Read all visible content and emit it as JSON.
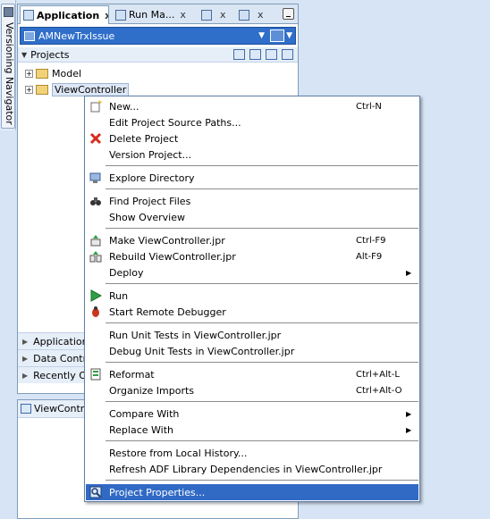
{
  "versioning_navigator": {
    "label": "Versioning Navigator"
  },
  "tabs": [
    {
      "label": "Application",
      "close": "x"
    },
    {
      "label": "Run Ma...",
      "close": "x"
    },
    {
      "label": "",
      "close": "x"
    },
    {
      "label": "",
      "close": "x"
    }
  ],
  "app_selector": {
    "label": "AMNewTrxIssue",
    "dropdown": "▼"
  },
  "projects_header": {
    "title": "Projects"
  },
  "tree": [
    {
      "label": "Model",
      "expander": "+"
    },
    {
      "label": "ViewController",
      "expander": "+"
    }
  ],
  "accordions": [
    {
      "label": "Application R"
    },
    {
      "label": "Data Contro"
    },
    {
      "label": "Recently Op"
    }
  ],
  "structure_tab": {
    "label": "ViewContro"
  },
  "context_menu": {
    "items": [
      {
        "label": "New...",
        "shortcut": "Ctrl-N",
        "icon": "new-icon"
      },
      {
        "label": "Edit Project Source Paths...",
        "shortcut": "",
        "icon": ""
      },
      {
        "label": "Delete Project",
        "shortcut": "",
        "icon": "delete-icon"
      },
      {
        "label": "Version Project...",
        "shortcut": "",
        "icon": ""
      },
      {
        "label": "Explore Directory",
        "shortcut": "",
        "icon": "explore-icon"
      },
      {
        "label": "Find Project Files",
        "shortcut": "",
        "icon": "binoculars-icon"
      },
      {
        "label": "Show Overview",
        "shortcut": "",
        "icon": ""
      },
      {
        "label": "Make ViewController.jpr",
        "shortcut": "Ctrl-F9",
        "icon": "make-icon"
      },
      {
        "label": "Rebuild ViewController.jpr",
        "shortcut": "Alt-F9",
        "icon": "rebuild-icon"
      },
      {
        "label": "Deploy",
        "shortcut": "",
        "icon": "",
        "submenu": "▶"
      },
      {
        "label": "Run",
        "shortcut": "",
        "icon": "run-icon"
      },
      {
        "label": "Start Remote Debugger",
        "shortcut": "",
        "icon": "debug-icon"
      },
      {
        "label": "Run Unit Tests in ViewController.jpr",
        "shortcut": "",
        "icon": ""
      },
      {
        "label": "Debug Unit Tests in ViewController.jpr",
        "shortcut": "",
        "icon": ""
      },
      {
        "label": "Reformat",
        "shortcut": "Ctrl+Alt-L",
        "icon": "reformat-icon"
      },
      {
        "label": "Organize Imports",
        "shortcut": "Ctrl+Alt-O",
        "icon": ""
      },
      {
        "label": "Compare With",
        "shortcut": "",
        "icon": "",
        "submenu": "▶"
      },
      {
        "label": "Replace With",
        "shortcut": "",
        "icon": "",
        "submenu": "▶"
      },
      {
        "label": "Restore from Local History...",
        "shortcut": "",
        "icon": ""
      },
      {
        "label": "Refresh ADF Library Dependencies in ViewController.jpr",
        "shortcut": "",
        "icon": ""
      },
      {
        "label": "Project Properties...",
        "shortcut": "",
        "icon": "properties-icon"
      }
    ]
  },
  "colors": {
    "highlight": "#316ac5",
    "app_bar": "#2f6ec9"
  }
}
